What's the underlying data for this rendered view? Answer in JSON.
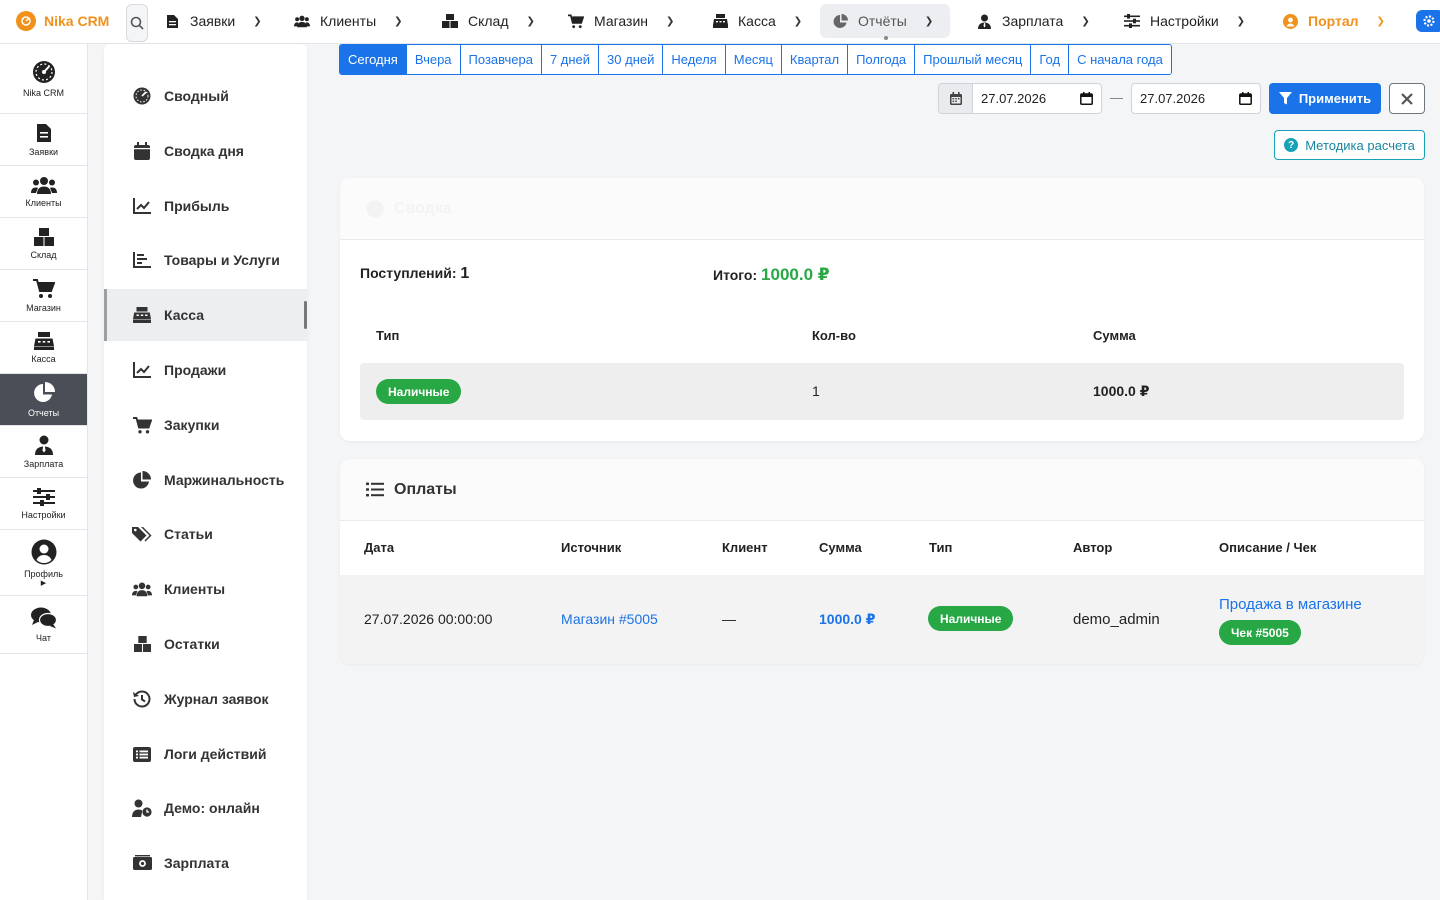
{
  "brand": {
    "name": "Nika CRM"
  },
  "topnav": {
    "items": [
      {
        "label": "Заявки"
      },
      {
        "label": "Клиенты"
      },
      {
        "label": "Склад"
      },
      {
        "label": "Магазин"
      },
      {
        "label": "Касса"
      },
      {
        "label": "Отчёты"
      },
      {
        "label": "Зарплата"
      },
      {
        "label": "Настройки"
      },
      {
        "label": "Портал"
      }
    ]
  },
  "leftbar": {
    "items": [
      {
        "label": "Nika CRM",
        "icon": "speedometer-icon"
      },
      {
        "label": "Заявки",
        "icon": "document-icon"
      },
      {
        "label": "Клиенты",
        "icon": "users-icon"
      },
      {
        "label": "Склад",
        "icon": "boxes-icon"
      },
      {
        "label": "Магазин",
        "icon": "cart-icon"
      },
      {
        "label": "Касса",
        "icon": "cash-register-icon"
      },
      {
        "label": "Отчеты",
        "icon": "pie-chart-icon"
      },
      {
        "label": "Зарплата",
        "icon": "user-tie-icon"
      },
      {
        "label": "Настройки",
        "icon": "sliders-icon"
      },
      {
        "label": "Профиль",
        "icon": "user-circle-icon"
      },
      {
        "label": "Чат",
        "icon": "chat-icon"
      }
    ]
  },
  "submenu": {
    "items": [
      {
        "label": "Сводный",
        "icon": "gauge-icon"
      },
      {
        "label": "Сводка дня",
        "icon": "calendar-day-icon"
      },
      {
        "label": "Прибыль",
        "icon": "line-chart-icon"
      },
      {
        "label": "Товары и Услуги",
        "icon": "bar-chart-icon"
      },
      {
        "label": "Касса",
        "icon": "cash-register-icon"
      },
      {
        "label": "Продажи",
        "icon": "line-chart-icon"
      },
      {
        "label": "Закупки",
        "icon": "cart-icon"
      },
      {
        "label": "Маржинальность",
        "icon": "pie-chart-icon"
      },
      {
        "label": "Статьи",
        "icon": "tags-icon"
      },
      {
        "label": "Клиенты",
        "icon": "users-icon"
      },
      {
        "label": "Остатки",
        "icon": "boxes-icon"
      },
      {
        "label": "Журнал заявок",
        "icon": "history-icon"
      },
      {
        "label": "Логи действий",
        "icon": "list-alt-icon"
      },
      {
        "label": "Демо: онлайн",
        "icon": "user-clock-icon"
      },
      {
        "label": "Зарплата",
        "icon": "money-icon"
      }
    ]
  },
  "periods": [
    "Сегодня",
    "Вчера",
    "Позавчера",
    "7 дней",
    "30 дней",
    "Неделя",
    "Месяц",
    "Квартал",
    "Полгода",
    "Прошлый месяц",
    "Год",
    "С начала года"
  ],
  "filter": {
    "date_from": "27.07.2026",
    "date_to": "27.07.2026",
    "separator": "—",
    "apply_label": "Применить",
    "method_label": "Методика расчета"
  },
  "summary": {
    "title": "Сводка",
    "receipts_label": "Поступлений:",
    "receipts_count": "1",
    "total_label": "Итого:",
    "total_value": "1000.0 ₽",
    "headers": {
      "type": "Тип",
      "count": "Кол-во",
      "sum": "Сумма"
    },
    "row": {
      "type": "Наличные",
      "count": "1",
      "sum": "1000.0 ₽"
    }
  },
  "payments": {
    "title": "Оплаты",
    "headers": {
      "date": "Дата",
      "source": "Источник",
      "client": "Клиент",
      "sum": "Сумма",
      "type": "Тип",
      "author": "Автор",
      "desc": "Описание / Чек"
    },
    "row": {
      "date": "27.07.2026 00:00:00",
      "source": "Магазин #5005",
      "client": "—",
      "sum": "1000.0 ₽",
      "type": "Наличные",
      "author": "demo_admin",
      "desc": "Продажа в магазине",
      "receipt": "Чек #5005"
    }
  },
  "colors": {
    "primary": "#1a73e8",
    "success": "#28a745",
    "brand": "#f0911c",
    "info": "#17a2b8"
  }
}
